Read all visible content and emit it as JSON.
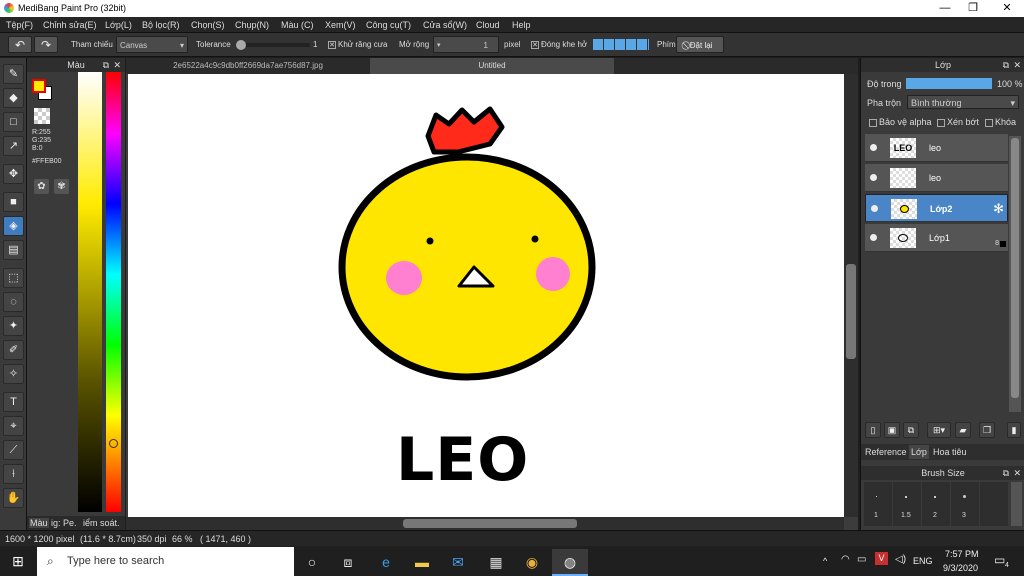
{
  "window": {
    "title": "MediBang Paint Pro (32bit)",
    "minimize": "—",
    "maximize": "❐",
    "close": "✕"
  },
  "menu": [
    "Tệp(F)",
    "Chỉnh sửa(E)",
    "Lớp(L)",
    "Bộ lọc(R)",
    "Chọn(S)",
    "Chụp(N)",
    "Màu (C)",
    "Xem(V)",
    "Công cụ(T)",
    "Cửa sổ(W)",
    "Cloud",
    "Help"
  ],
  "toolbar": {
    "undo": "↶",
    "redo": "↷",
    "reference_label": "Tham chiếu",
    "reference_value": "Canvas",
    "tolerance_label": "Tolerance",
    "tolerance_value": "1",
    "antialias_label": "Khử răng cưa",
    "antialias_check": "✕",
    "expand_label": "Mở rộng",
    "expand_value": "1",
    "expand_unit": "pixel",
    "closegap_label": "Đóng khe hở",
    "closegap_check": "✕",
    "key_label": "Phím",
    "reset_label": "Đặt lại",
    "tolerance_level": 0.0
  },
  "tools": [
    {
      "name": "brush-icon",
      "glyph": "✎"
    },
    {
      "name": "eraser-icon",
      "glyph": "◆"
    },
    {
      "name": "rect-shape-icon",
      "glyph": "□"
    },
    {
      "name": "dot-brush-icon",
      "glyph": "↗"
    },
    {
      "name": "move-icon",
      "glyph": "✥"
    },
    {
      "name": "fill-rect-icon",
      "glyph": "■"
    },
    {
      "name": "bucket-icon",
      "glyph": "◈"
    },
    {
      "name": "gradient-icon",
      "glyph": "▤"
    },
    {
      "name": "select-rect-icon",
      "glyph": "⬚"
    },
    {
      "name": "lasso-icon",
      "glyph": "◌"
    },
    {
      "name": "magic-wand-icon",
      "glyph": "✦"
    },
    {
      "name": "select-pen-icon",
      "glyph": "✐"
    },
    {
      "name": "select-eraser-icon",
      "glyph": "✧"
    },
    {
      "name": "text-icon",
      "glyph": "T"
    },
    {
      "name": "operation-icon",
      "glyph": "⌖"
    },
    {
      "name": "divide-icon",
      "glyph": "⟋"
    },
    {
      "name": "eyedropper-icon",
      "glyph": "⟊"
    },
    {
      "name": "hand-icon",
      "glyph": "✋"
    }
  ],
  "color_panel": {
    "title": "Màu",
    "r": "R:255",
    "g": "G:235",
    "b": "B:0",
    "hex": "#FFEB00",
    "foreground": "#FFEB00",
    "background": "#FFFFFF",
    "tabs": [
      "Màu",
      "ig: Pe.",
      "iểm soát."
    ]
  },
  "canvas": {
    "tabs": [
      "2e6522a4c9c9db0ff2669da7ae756d87.jpg",
      "Untitled"
    ],
    "text": "LEO",
    "colors": {
      "face": "#FFE600",
      "crown": "#FF2A1A",
      "cheek": "#FF7FD0",
      "outline": "#000000"
    }
  },
  "layers_panel": {
    "title": "Lớp",
    "opacity_label": "Độ trong",
    "opacity_value": "100 %",
    "opacity_level": 1.0,
    "blend_label": "Pha trộn",
    "blend_value": "Bình thường",
    "protect_alpha": "Bảo vệ alpha",
    "clipping": "Xén bớt",
    "lock": "Khóa",
    "layers": [
      {
        "name": "leo",
        "thumb": "LEO",
        "selected": false
      },
      {
        "name": "leo",
        "thumb": "",
        "selected": false
      },
      {
        "name": "Lớp2",
        "thumb": "",
        "selected": true
      },
      {
        "name": "Lớp1",
        "thumb": "",
        "selected": false
      }
    ],
    "layer1_badge": "8",
    "bottom_tabs": [
      "Reference",
      "Lớp",
      "Hoa tiêu"
    ]
  },
  "brush_panel": {
    "title": "Brush Size",
    "sizes": [
      "1",
      "1.5",
      "2",
      "3"
    ]
  },
  "status": {
    "dimensions": "1600 * 1200 pixel",
    "cm": "(11.6 * 8.7cm)",
    "dpi": "350 dpi",
    "zoom": "66 %",
    "coords": "( 1471, 460 )"
  },
  "taskbar": {
    "search_placeholder": "Type here to search",
    "lang": "ENG",
    "time": "7:57 PM",
    "date": "9/3/2020",
    "notification_count": "4"
  }
}
